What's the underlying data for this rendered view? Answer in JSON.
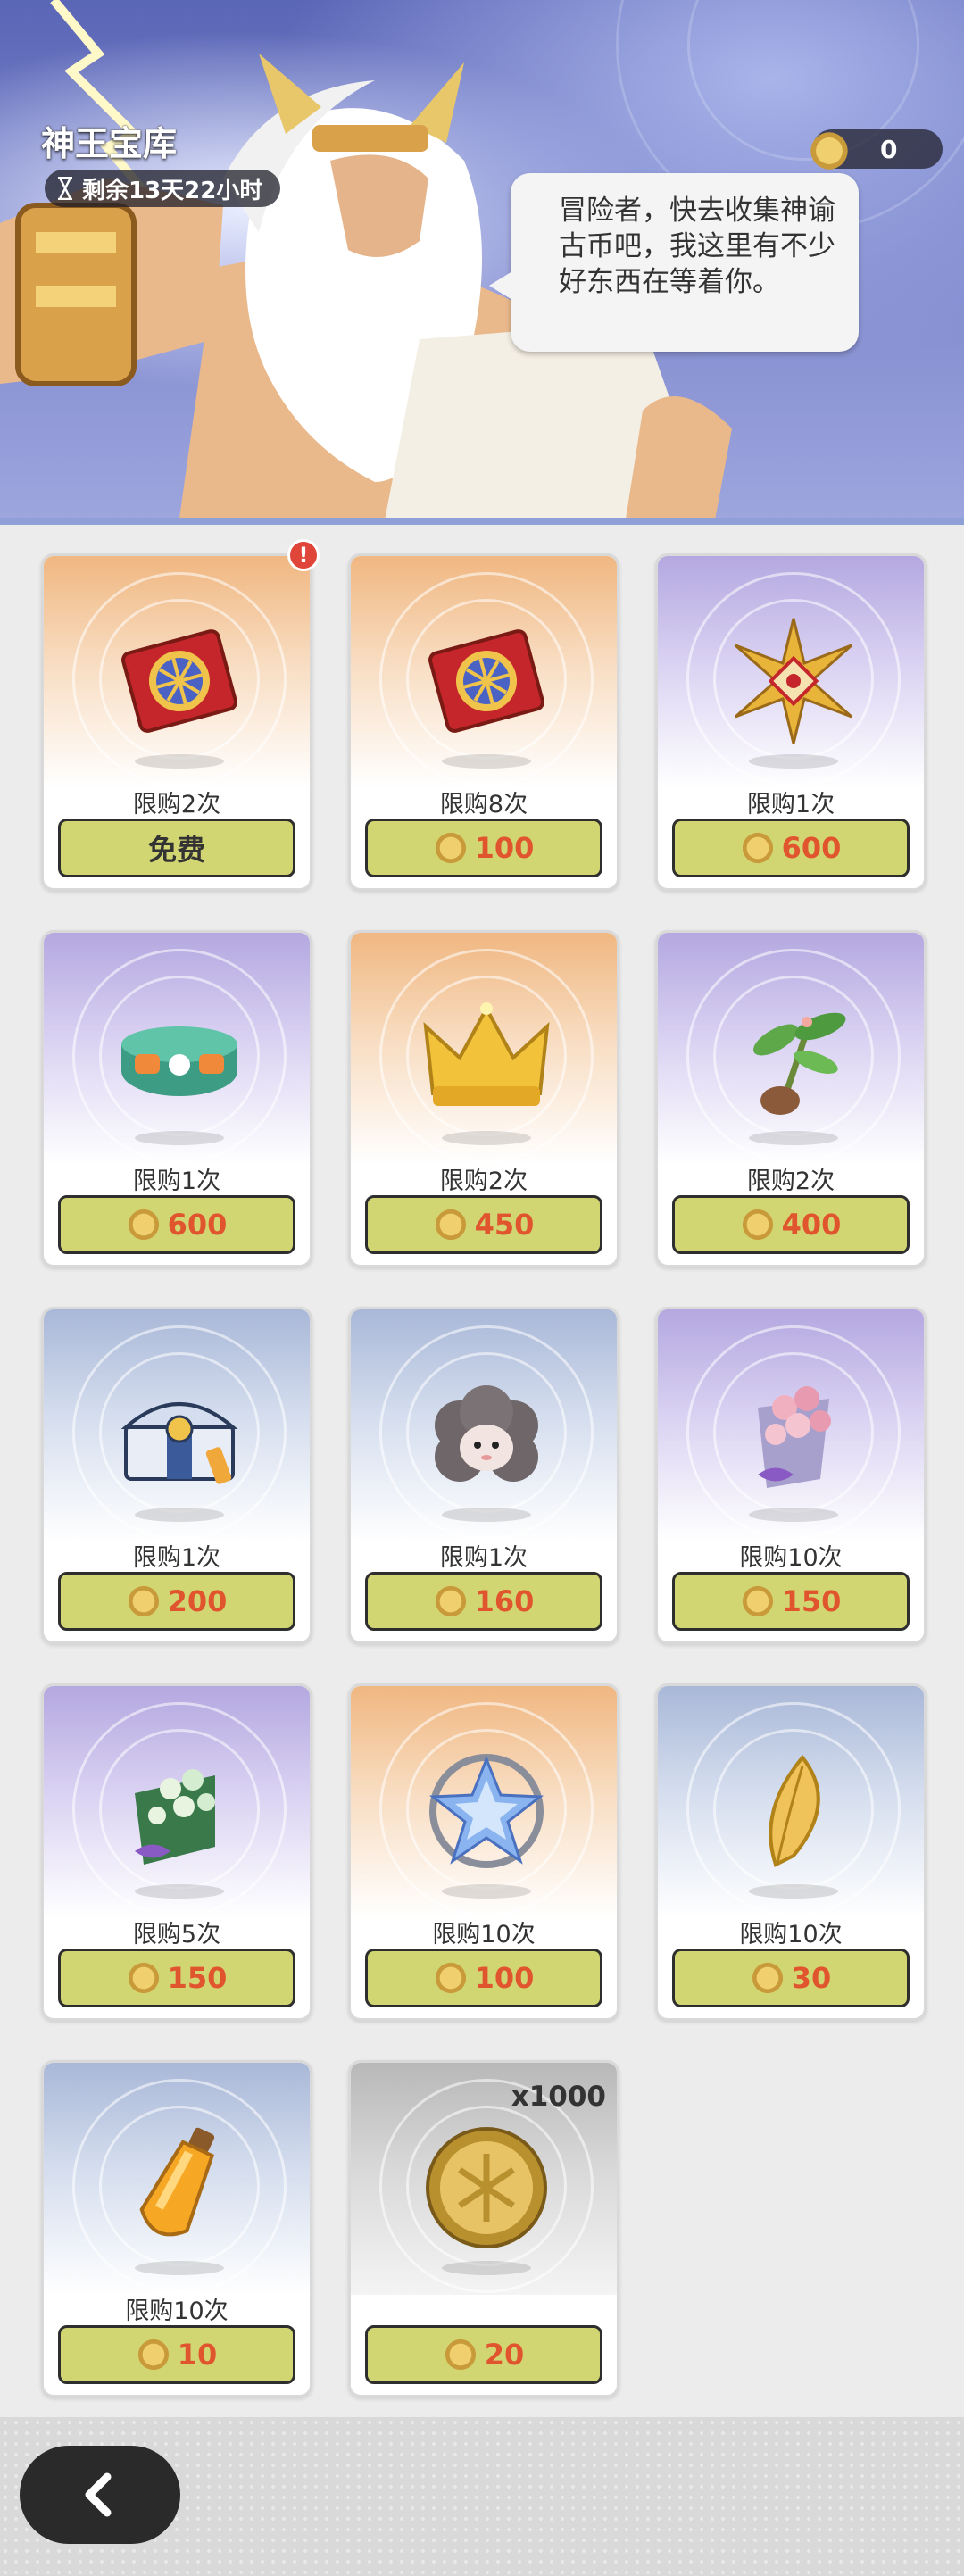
{
  "header": {
    "title": "神王宝库",
    "timer": "剩余13天22小时",
    "coin_balance": "0",
    "npc_dialogue": "冒险者，快去收集神谕古币吧，我这里有不少好东西在等着你。"
  },
  "shop_items": [
    {
      "name": "ticket",
      "limit": "限购2次",
      "price": "免费",
      "free": true,
      "badge": "!"
    },
    {
      "name": "ticket",
      "limit": "限购8次",
      "price": "100"
    },
    {
      "name": "sun-emblem",
      "limit": "限购1次",
      "price": "600"
    },
    {
      "name": "ring-band",
      "limit": "限购1次",
      "price": "600"
    },
    {
      "name": "crown",
      "limit": "限购2次",
      "price": "450"
    },
    {
      "name": "sapling",
      "limit": "限购2次",
      "price": "400"
    },
    {
      "name": "treasure-chest",
      "limit": "限购1次",
      "price": "200"
    },
    {
      "name": "sheep-plush",
      "limit": "限购1次",
      "price": "160"
    },
    {
      "name": "cherry-bouquet",
      "limit": "限购10次",
      "price": "150"
    },
    {
      "name": "lily-bouquet",
      "limit": "限购5次",
      "price": "150"
    },
    {
      "name": "crystal-star",
      "limit": "限购10次",
      "price": "100"
    },
    {
      "name": "golden-leaf",
      "limit": "限购10次",
      "price": "30"
    },
    {
      "name": "potion-vial",
      "limit": "限购10次",
      "price": "10"
    },
    {
      "name": "ancient-coin",
      "qty": "x1000",
      "price": "20"
    }
  ],
  "colors": {
    "price_text": "#e0552e",
    "button_bg": "#d2d672",
    "badge": "#e0453a"
  }
}
